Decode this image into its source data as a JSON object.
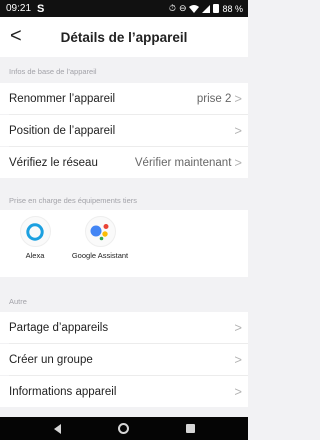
{
  "status_bar": {
    "time": "09:21",
    "app_glyph": "S",
    "alarm_icon": "⏱",
    "dnd_icon": "⊖",
    "wifi_icon": "wifi-icon",
    "battery_text": "88 %"
  },
  "header": {
    "back_glyph": "<",
    "title": "Détails de l’appareil"
  },
  "sections": {
    "basic": "Infos de base de l’appareil",
    "third_party": "Prise en charge des équipements tiers",
    "other": "Autre"
  },
  "basic_rows": [
    {
      "label": "Renommer l’appareil",
      "value": "prise 2"
    },
    {
      "label": "Position de l’appareil",
      "value": ""
    },
    {
      "label": "Vérifiez le réseau",
      "value": "Vérifier maintenant"
    }
  ],
  "third_party": [
    {
      "label": "Alexa",
      "icon": "alexa-icon"
    },
    {
      "label": "Google Assistant",
      "icon": "google-assistant-icon"
    }
  ],
  "other_rows": [
    {
      "label": "Partage d’appareils"
    },
    {
      "label": "Créer un groupe"
    },
    {
      "label": "Informations appareil"
    }
  ],
  "chevron": ">",
  "colors": {
    "alexa": "#1ca0e0",
    "google_blue": "#4285f4",
    "google_red": "#ea4335",
    "google_yellow": "#fbbc05",
    "google_green": "#34a853"
  }
}
